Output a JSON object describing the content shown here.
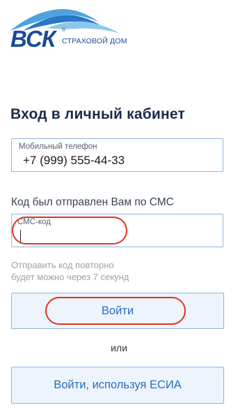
{
  "logo": {
    "letters": "ВСК",
    "registered": "®",
    "subtitle": "СТРАХОВОЙ ДОМ"
  },
  "title": "Вход в личный кабинет",
  "phone": {
    "label": "Мобильный телефон",
    "value": "+7 (999) 555-44-33"
  },
  "sms": {
    "hint": "Код был отправлен Вам по СМС",
    "label": "СМС-код",
    "value": ""
  },
  "resend": {
    "line1": "Отправить код повторно",
    "line2": "будет можно через 7 секунд"
  },
  "buttons": {
    "login": "Войти",
    "or": "или",
    "esia": "Войти, используя ЕСИА"
  },
  "colors": {
    "brand": "#1b4a96",
    "accent_blue": "#2c6cc0",
    "annotation_red": "#e0331f"
  }
}
